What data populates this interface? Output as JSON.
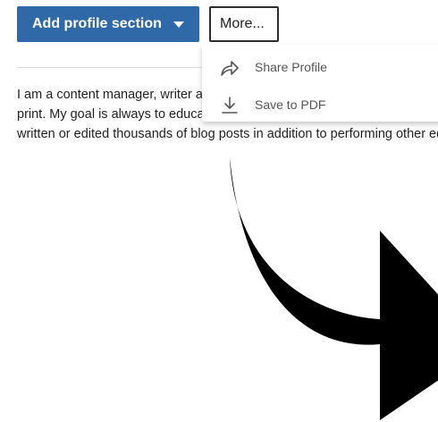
{
  "toolbar": {
    "add_section_label": "Add profile section",
    "more_label": "More..."
  },
  "more_menu": {
    "items": [
      {
        "label": "Share Profile",
        "icon": "share-icon"
      },
      {
        "label": "Save to PDF",
        "icon": "download-icon"
      }
    ]
  },
  "summary": {
    "line1": "I am a content manager, writer and editor with experience working in digital and",
    "line2": "print. My goal is always to educate, inform and entertain with content. I have",
    "line3": "written or edited thousands of blog posts in addition to performing other editing"
  },
  "colors": {
    "primary_button": "#2f69a8",
    "arrow": "#000000"
  }
}
